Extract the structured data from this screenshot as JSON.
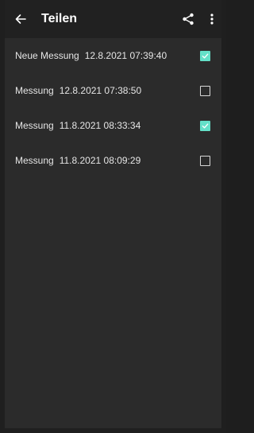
{
  "toolbar": {
    "title": "Teilen",
    "back_icon": "arrow-left-icon",
    "share_icon": "share-icon",
    "overflow_icon": "more-vert-icon"
  },
  "colors": {
    "toolbar_bg": "#212121",
    "list_bg": "#2b2b2b",
    "accent": "#64e0c8",
    "text": "#e6e6e6"
  },
  "measurements": [
    {
      "name": "Neue Messung",
      "datetime": "12.8.2021 07:39:40",
      "checked": true
    },
    {
      "name": "Messung",
      "datetime": "12.8.2021 07:38:50",
      "checked": false
    },
    {
      "name": "Messung",
      "datetime": "11.8.2021 08:33:34",
      "checked": true
    },
    {
      "name": "Messung",
      "datetime": "11.8.2021 08:09:29",
      "checked": false
    }
  ]
}
